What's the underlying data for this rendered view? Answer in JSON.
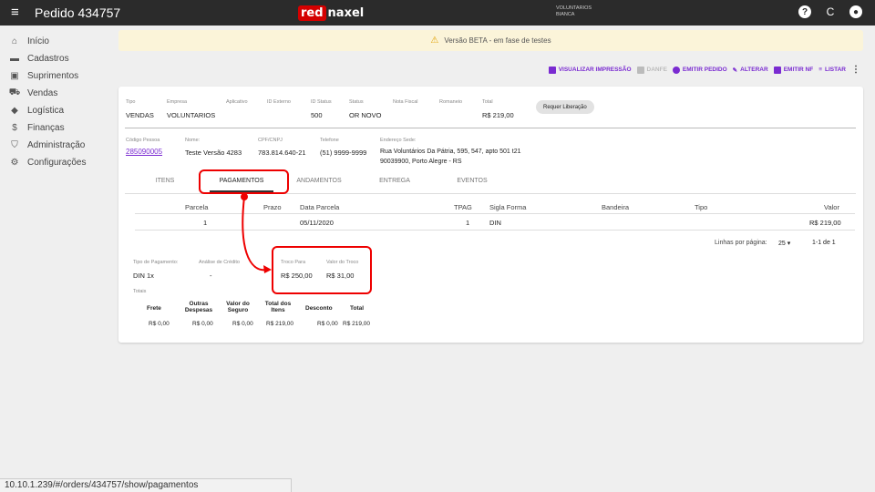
{
  "topbar": {
    "menu_icon": "≡",
    "title": "Pedido 434757",
    "logo_red": "red",
    "logo_white": "naxel",
    "user_line1": "VOLUNTARIOS",
    "user_line2": "BIANCA",
    "icons": [
      "help-icon",
      "refresh-icon",
      "account-icon"
    ]
  },
  "sidebar": {
    "items": [
      {
        "label": "Início",
        "icon": "home-icon",
        "glyph": "⌂"
      },
      {
        "label": "Cadastros",
        "icon": "folder-icon",
        "glyph": "▬"
      },
      {
        "label": "Suprimentos",
        "icon": "briefcase-icon",
        "glyph": "▣"
      },
      {
        "label": "Vendas",
        "icon": "cart-icon",
        "glyph": "⛟"
      },
      {
        "label": "Logística",
        "icon": "diamond-icon",
        "glyph": "◆"
      },
      {
        "label": "Finanças",
        "icon": "dollar-icon",
        "glyph": "$"
      },
      {
        "label": "Administração",
        "icon": "shield-icon",
        "glyph": "⛉"
      },
      {
        "label": "Configurações",
        "icon": "gear-icon",
        "glyph": "⚙"
      }
    ]
  },
  "banner": {
    "text": "Versão BETA - em fase de testes"
  },
  "actions": {
    "visualizar": "VISUALIZAR IMPRESSÃO",
    "danfe": "DANFE",
    "emitir_pedido": "EMITIR PEDIDO",
    "alterar": "ALTERAR",
    "emitir_nf": "EMITIR NF",
    "listar": "LISTAR",
    "more": "⋮"
  },
  "order": {
    "labels": {
      "tipo": "Tipo",
      "empresa": "Empresa",
      "aplicativo": "Aplicativo",
      "id_externo": "ID Externo",
      "id_status": "ID Status",
      "status": "Status",
      "nota_fiscal": "Nota Fiscal",
      "romaneio": "Romaneio",
      "total": "Total"
    },
    "tipo": "VENDAS",
    "empresa": "VOLUNTARIOS",
    "id_status": "500",
    "status": "OR NOVO",
    "total": "R$ 219,00",
    "req_button": "Requer Liberação"
  },
  "person": {
    "labels": {
      "codigo": "Código Pessoa",
      "nome": "Nome:",
      "cpf": "CPF/CNPJ",
      "telefone": "Telefone",
      "endereco": "Endereço Sede:"
    },
    "codigo": "285090005",
    "nome": "Teste Versão 4283",
    "cpf": "783.814.640-21",
    "telefone": "(51) 9999-9999",
    "endereco1": "Rua Voluntários Da Pátria, 595, 547, apto 501 t21",
    "endereco2": "90039900, Porto Alegre - RS"
  },
  "tabs": [
    "ITENS",
    "PAGAMENTOS",
    "ANDAMENTOS",
    "ENTREGA",
    "EVENTOS"
  ],
  "table": {
    "headers": {
      "parcela": "Parcela",
      "prazo": "Prazo",
      "data": "Data Parcela",
      "tpag": "TPAG",
      "sigla": "Sigla Forma",
      "bandeira": "Bandeira",
      "tipo": "Tipo",
      "valor": "Valor"
    },
    "row": {
      "parcela": "1",
      "data": "05/11/2020",
      "tpag": "1",
      "sigla": "DIN",
      "valor": "R$ 219,00"
    },
    "pagination": {
      "label": "Linhas por página:",
      "per_page": "25",
      "dropdown": "▾",
      "range": "1-1 de 1"
    }
  },
  "payment": {
    "labels": {
      "tipo": "Tipo de Pagamento:",
      "analise": "Análise de Crédito",
      "troco_para": "Troco Para",
      "valor_troco": "Valor do Troco"
    },
    "tipo": "DIN 1x",
    "analise": "-",
    "troco_para": "R$ 250,00",
    "valor_troco": "R$ 31,00"
  },
  "totals": {
    "label": "Totais",
    "headers": {
      "frete": "Frete",
      "outras_1": "Outras",
      "outras_2": "Despesas",
      "seguro_1": "Valor do",
      "seguro_2": "Seguro",
      "itens_1": "Total dos",
      "itens_2": "Itens",
      "desconto": "Desconto",
      "total": "Total"
    },
    "values": {
      "frete": "R$ 0,00",
      "outras": "R$ 0,00",
      "seguro": "R$ 0,00",
      "itens": "R$ 219,00",
      "desconto": "R$ 0,00",
      "total": "R$ 219,00"
    }
  },
  "status_url": "10.10.1.239/#/orders/434757/show/pagamentos",
  "colors": {
    "accent": "#7a2bd1",
    "highlight": "#e00000",
    "topbar": "#2b2b2b"
  }
}
